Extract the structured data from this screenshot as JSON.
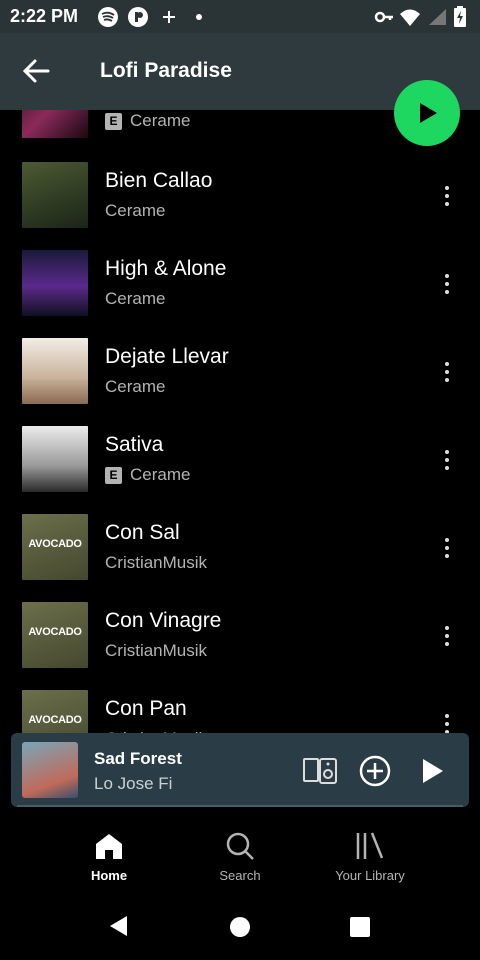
{
  "status_bar": {
    "time": "2:22 PM"
  },
  "header": {
    "title": "Lofi Paradise"
  },
  "tracks": [
    {
      "name": "",
      "artist": "Cerame",
      "explicit": true
    },
    {
      "name": "Bien Callao",
      "artist": "Cerame",
      "explicit": false
    },
    {
      "name": "High & Alone",
      "artist": "Cerame",
      "explicit": false
    },
    {
      "name": "Dejate Llevar",
      "artist": "Cerame",
      "explicit": false
    },
    {
      "name": "Sativa",
      "artist": "Cerame",
      "explicit": true
    },
    {
      "name": "Con Sal",
      "artist": "CristianMusik",
      "explicit": false
    },
    {
      "name": "Con Vinagre",
      "artist": "CristianMusik",
      "explicit": false
    },
    {
      "name": "Con Pan",
      "artist": "CristianMusik",
      "explicit": false
    }
  ],
  "art_labels": {
    "avocado": "AVOCADO"
  },
  "badge": {
    "explicit": "E"
  },
  "player": {
    "title": "Sad Forest",
    "artist": "Lo Jose Fi"
  },
  "nav": {
    "home": "Home",
    "search": "Search",
    "library": "Your Library"
  },
  "colors": {
    "accent": "#1ed760",
    "header": "#2f3a3e",
    "player": "#2a3d47"
  }
}
